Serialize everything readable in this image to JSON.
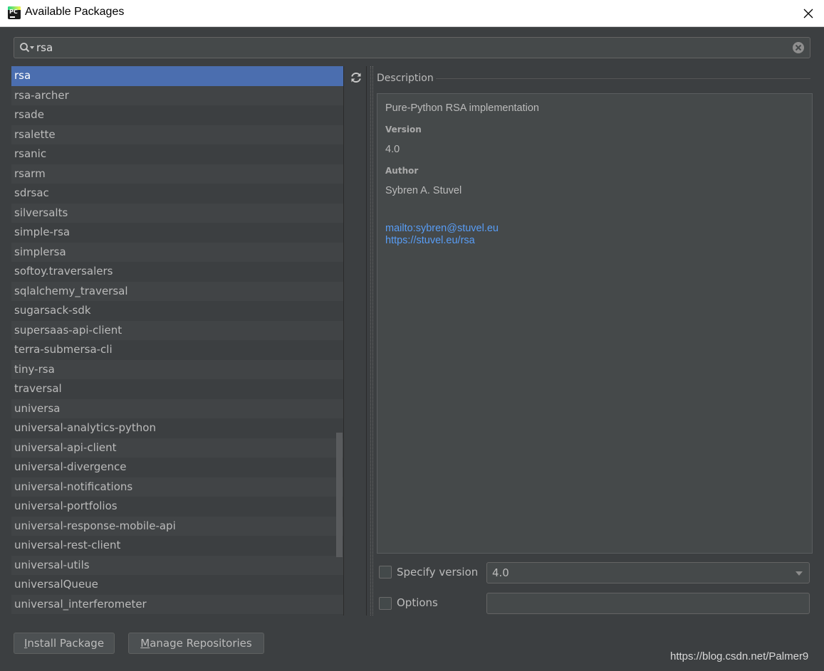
{
  "window": {
    "title": "Available Packages",
    "app_icon_text": "PC"
  },
  "search": {
    "value": "rsa"
  },
  "packages": [
    "rsa",
    "rsa-archer",
    "rsade",
    "rsalette",
    "rsanic",
    "rsarm",
    "sdrsac",
    "silversalts",
    "simple-rsa",
    "simplersa",
    "softoy.traversalers",
    "sqlalchemy_traversal",
    "sugarsack-sdk",
    "supersaas-api-client",
    "terra-submersa-cli",
    "tiny-rsa",
    "traversal",
    "universa",
    "universal-analytics-python",
    "universal-api-client",
    "universal-divergence",
    "universal-notifications",
    "universal-portfolios",
    "universal-response-mobile-api",
    "universal-rest-client",
    "universal-utils",
    "universalQueue",
    "universal_interferometer"
  ],
  "selected_index": 0,
  "description": {
    "label": "Description",
    "summary": "Pure-Python RSA implementation",
    "version_heading": "Version",
    "version": "4.0",
    "author_heading": "Author",
    "author": "Sybren A. Stuvel",
    "link_email": "mailto:sybren@stuvel.eu",
    "link_homepage": "https://stuvel.eu/rsa"
  },
  "options": {
    "specify_version_label": "Specify version",
    "specify_version_checked": false,
    "version_value": "4.0",
    "options_label": "Options",
    "options_checked": false,
    "options_value": ""
  },
  "buttons": {
    "install_mnemonic": "I",
    "install_rest": "nstall Package",
    "manage_mnemonic": "M",
    "manage_rest": "anage Repositories"
  },
  "watermark": "https://blog.csdn.net/Palmer9"
}
